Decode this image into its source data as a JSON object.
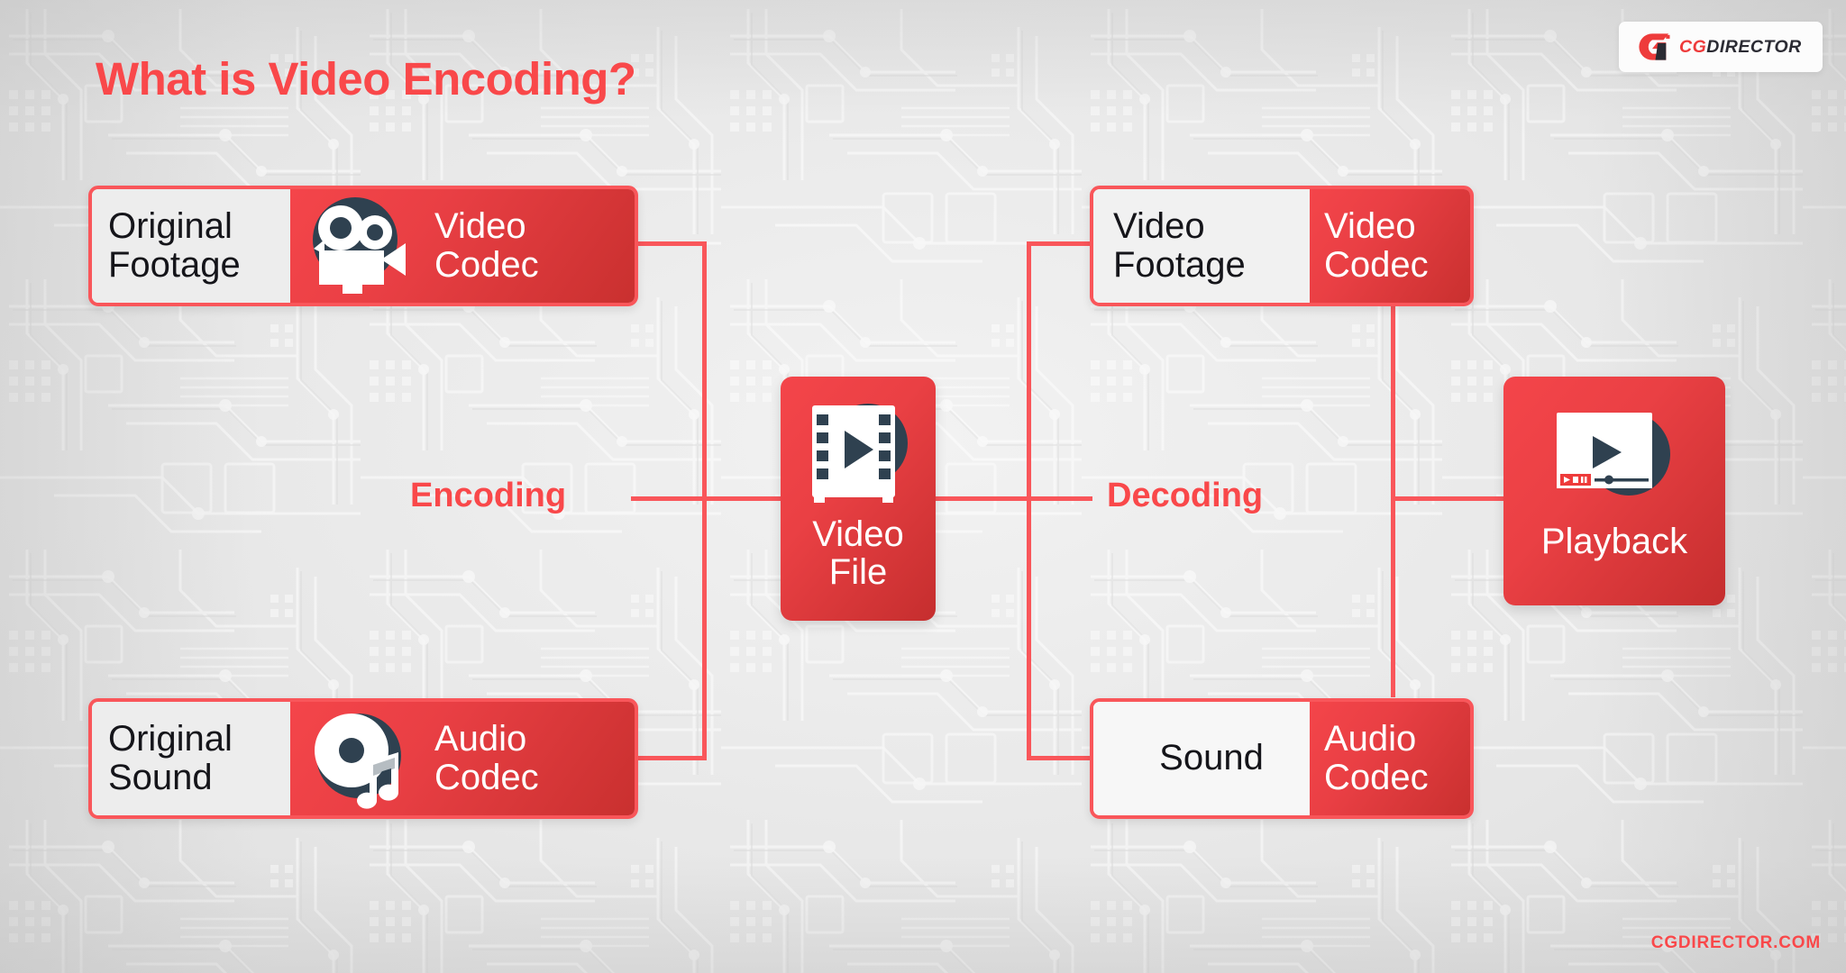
{
  "title": "What is Video Encoding?",
  "logo": {
    "mark": "cgdirector-logo-mark",
    "text_primary": "CG",
    "text_secondary": "DIRECTOR"
  },
  "footer": {
    "text_primary": "CG",
    "text_secondary": "DIRECTOR.COM"
  },
  "colors": {
    "accent_red": "#f9484a",
    "line_red": "#f9565a",
    "box_red_light": "#f4454a",
    "box_red_dark": "#c52e2e",
    "icon_dark": "#2f4150",
    "panel_gray": "#ededed",
    "background": "#e9e9e9"
  },
  "stages": {
    "encoding": "Encoding",
    "decoding": "Decoding"
  },
  "nodes": {
    "original_footage": {
      "input_label": "Original\nFootage",
      "codec_label": "Video\nCodec",
      "icon": "video-camera-icon"
    },
    "original_sound": {
      "input_label": "Original\nSound",
      "codec_label": "Audio\nCodec",
      "icon": "audio-disc-music-note-icon"
    },
    "video_file": {
      "label": "Video\nFile",
      "icon": "film-strip-play-icon"
    },
    "video_footage_out": {
      "input_label": "Video\nFootage",
      "codec_label": "Video\nCodec",
      "icon": "none"
    },
    "sound_out": {
      "input_label": "Sound",
      "codec_label": "Audio\nCodec",
      "icon": "none"
    },
    "playback": {
      "label": "Playback",
      "icon": "video-player-window-icon"
    }
  }
}
